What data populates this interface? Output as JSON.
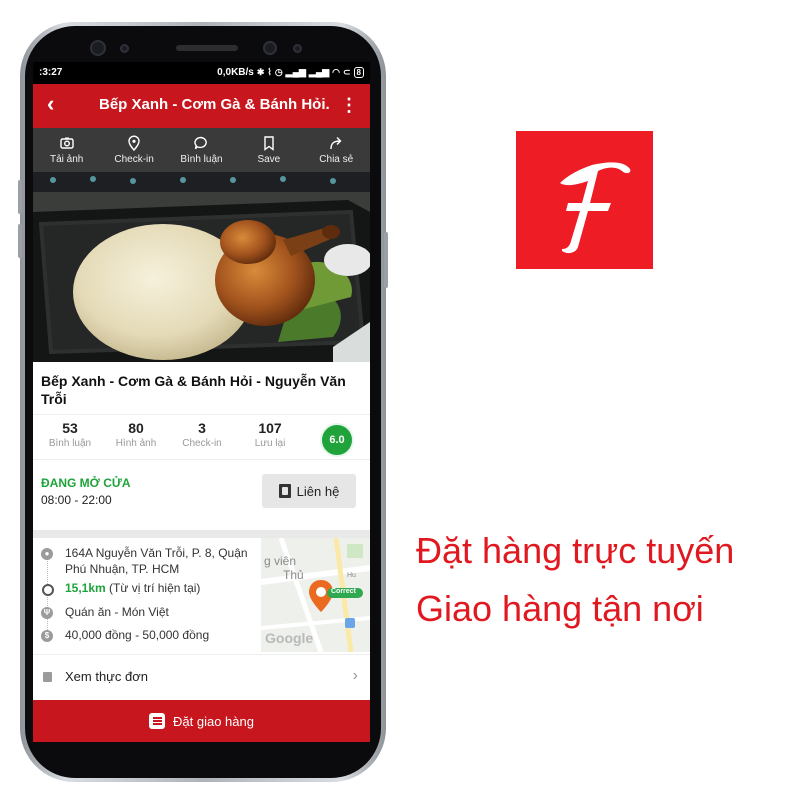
{
  "status_bar": {
    "time": ":3:27",
    "network_speed": "0,0KB/s",
    "battery": "8"
  },
  "app_bar": {
    "back_icon": "arrow-left-icon",
    "title": "Bếp Xanh - Cơm Gà & Bánh Hỏi...",
    "more_icon": "more-vertical-icon"
  },
  "actions": [
    {
      "label": "Tải ảnh",
      "icon": "camera-icon"
    },
    {
      "label": "Check-in",
      "icon": "location-pin-icon"
    },
    {
      "label": "Bình luận",
      "icon": "comment-icon"
    },
    {
      "label": "Save",
      "icon": "bookmark-icon"
    },
    {
      "label": "Chia sẻ",
      "icon": "share-icon"
    }
  ],
  "restaurant": {
    "name": "Bếp Xanh - Cơm Gà & Bánh Hỏi - Nguyễn Văn Trỗi",
    "stats": [
      {
        "value": "53",
        "label": "Bình luận"
      },
      {
        "value": "80",
        "label": "Hình ảnh"
      },
      {
        "value": "3",
        "label": "Check-in"
      },
      {
        "value": "107",
        "label": "Lưu lại"
      }
    ],
    "score": "6.0",
    "open_status": "ĐANG MỞ CỬA",
    "open_hours": "08:00 - 22:00",
    "contact_label": "Liên hệ",
    "address": "164A Nguyễn Văn Trỗi, P. 8, Quận Phú Nhuận, TP. HCM",
    "distance": "15,1km",
    "distance_note": "(Từ vị trí hiện tại)",
    "category": "Quán ăn - Món Việt",
    "price_range": "40,000 đồng - 50,000 đồng",
    "view_menu_label": "Xem thực đơn"
  },
  "map": {
    "label_top": "g viên",
    "label_mid": "Thủ",
    "label_small": "Hu",
    "pin_badge": "Correct",
    "google_logo": "Google"
  },
  "order_button": {
    "label": "Đặt giao hàng"
  },
  "brand": {
    "logo_letter": "F",
    "logo_color": "#ee1c25",
    "tagline_1": "Đặt hàng trực tuyến",
    "tagline_2": "Giao hàng tận nơi"
  },
  "colors": {
    "primary_red": "#c8161e",
    "open_green": "#1fa33a",
    "action_bar": "#3a3a3a"
  }
}
